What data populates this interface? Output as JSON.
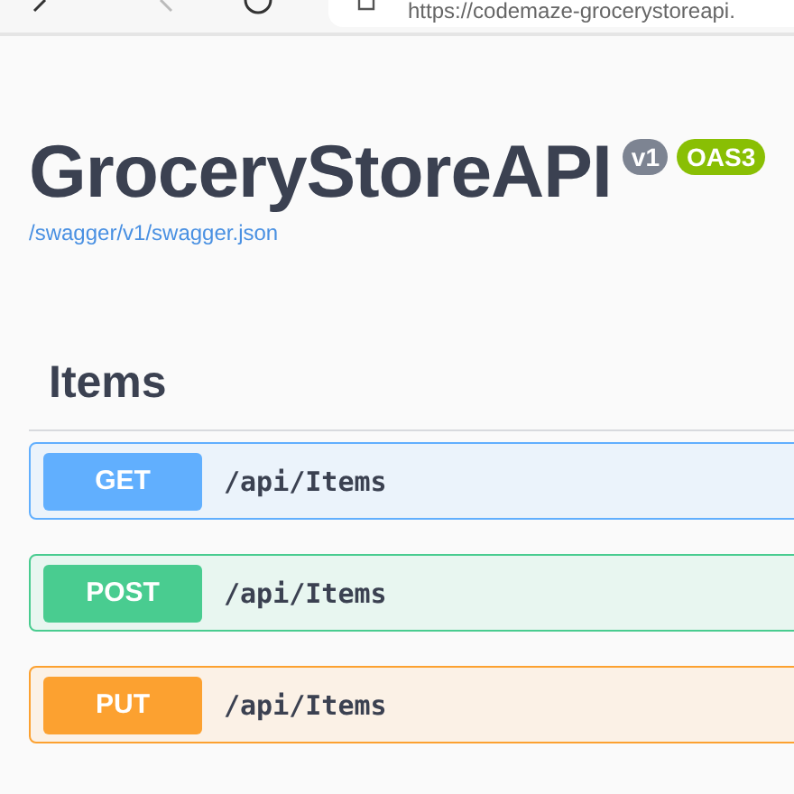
{
  "browser": {
    "url": "https://codemaze-grocerystoreapi."
  },
  "info": {
    "title": "GroceryStoreAPI",
    "version": "v1",
    "spec": "OAS3",
    "link": "/swagger/v1/swagger.json"
  },
  "tag": {
    "name": "Items"
  },
  "operations": [
    {
      "method": "GET",
      "path": "/api/Items"
    },
    {
      "method": "POST",
      "path": "/api/Items"
    },
    {
      "method": "PUT",
      "path": "/api/Items"
    }
  ]
}
